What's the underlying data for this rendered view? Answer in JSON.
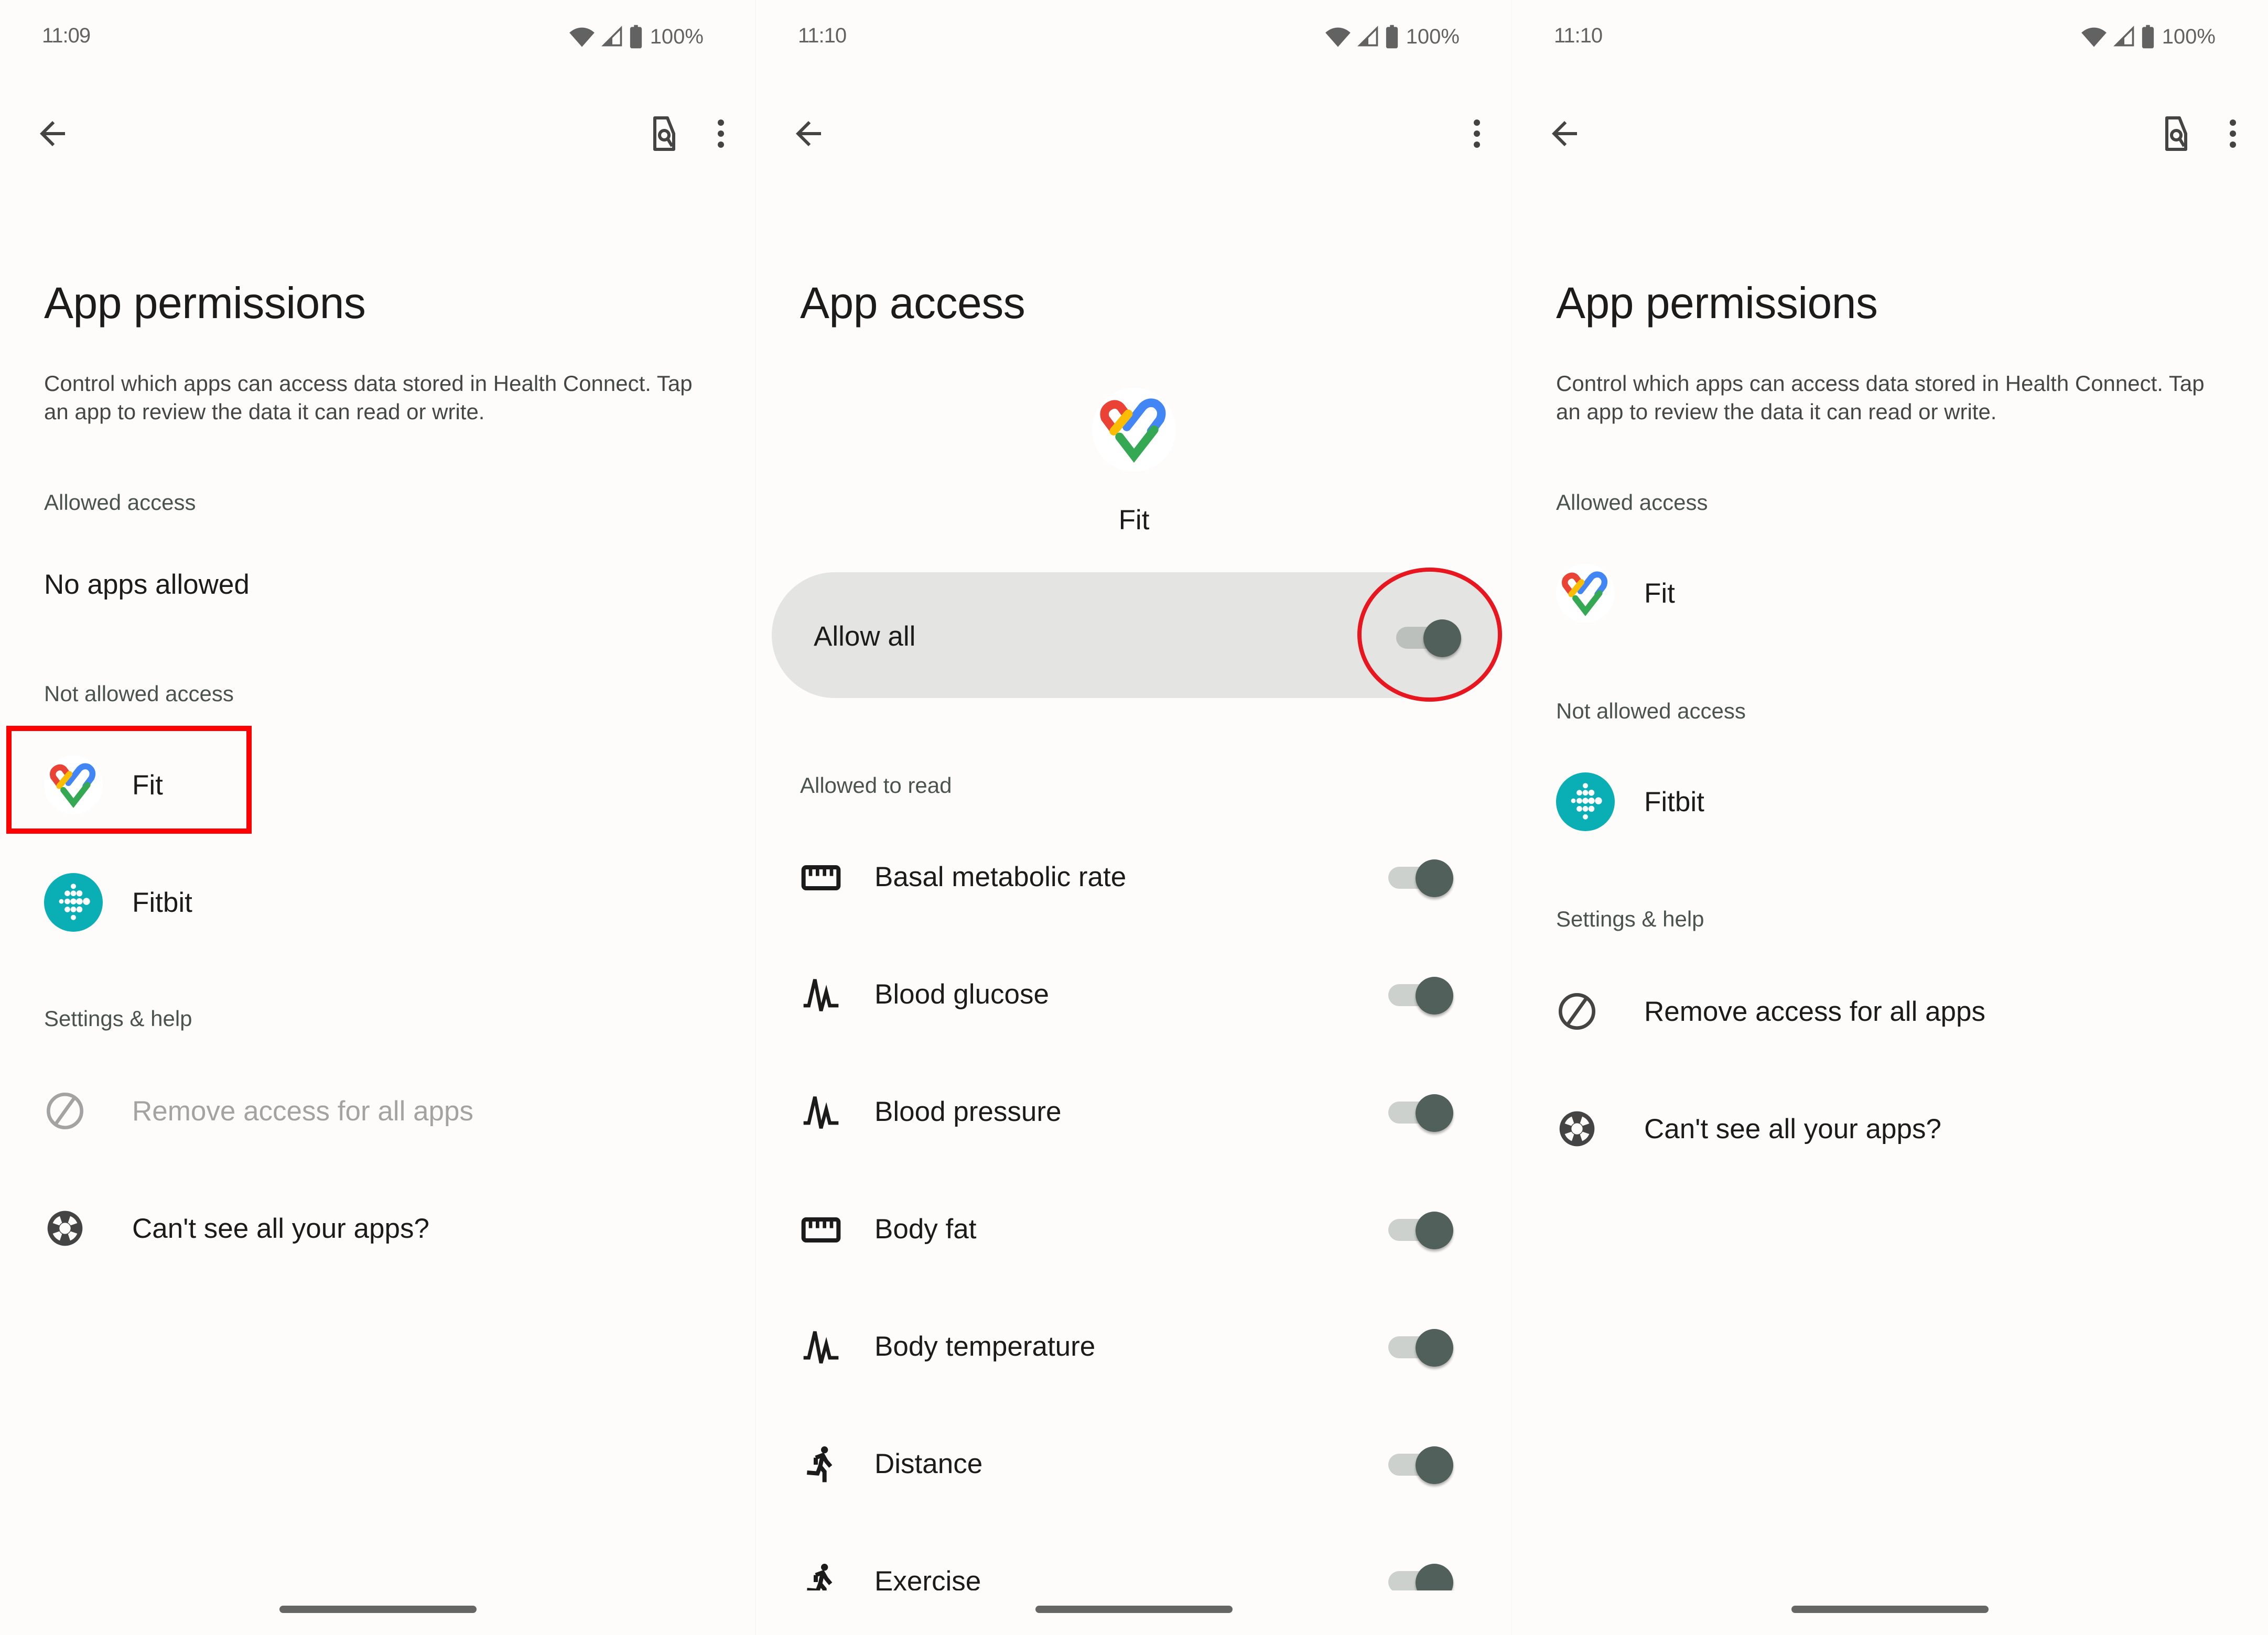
{
  "screens": [
    {
      "status": {
        "time": "11:09",
        "battery": "100%",
        "icons": [
          "wifi-icon",
          "signal-icon",
          "battery-icon"
        ]
      },
      "toolbar": {
        "back": "back-arrow-icon",
        "actions": [
          "search-document-icon",
          "more-vert-icon"
        ]
      },
      "title": "App permissions",
      "description": "Control which apps can access data stored in Health Connect. Tap an app to review the data it can read or write.",
      "sections": {
        "allowed_header": "Allowed access",
        "allowed_empty": "No apps allowed",
        "not_allowed_header": "Not allowed access",
        "not_allowed_apps": [
          {
            "name": "Fit",
            "icon": "google-fit-icon",
            "highlighted": true
          },
          {
            "name": "Fitbit",
            "icon": "fitbit-icon"
          }
        ],
        "settings_header": "Settings & help",
        "settings_items": [
          {
            "label": "Remove access for all apps",
            "icon": "block-icon",
            "enabled": false
          },
          {
            "label": "Can't see all your apps?",
            "icon": "lifebuoy-help-icon",
            "enabled": true
          }
        ]
      },
      "annotation": {
        "type": "rectangle",
        "color": "#ff0000",
        "target": "Fit"
      }
    },
    {
      "status": {
        "time": "11:10",
        "battery": "100%",
        "icons": [
          "wifi-icon",
          "signal-icon",
          "battery-icon"
        ]
      },
      "toolbar": {
        "back": "back-arrow-icon",
        "actions": [
          "more-vert-icon"
        ]
      },
      "title": "App access",
      "app": {
        "name": "Fit",
        "icon": "google-fit-icon"
      },
      "allow_all": {
        "label": "Allow all",
        "checked": true
      },
      "allowed_to_read_header": "Allowed to read",
      "permissions": [
        {
          "label": "Basal metabolic rate",
          "icon": "scale-ruler-icon",
          "checked": true
        },
        {
          "label": "Blood glucose",
          "icon": "vital-signs-icon",
          "checked": true
        },
        {
          "label": "Blood pressure",
          "icon": "vital-signs-icon",
          "checked": true
        },
        {
          "label": "Body fat",
          "icon": "scale-ruler-icon",
          "checked": true
        },
        {
          "label": "Body temperature",
          "icon": "vital-signs-icon",
          "checked": true
        },
        {
          "label": "Distance",
          "icon": "running-person-icon",
          "checked": true
        },
        {
          "label": "Exercise",
          "icon": "running-person-icon",
          "checked": true
        }
      ],
      "annotation": {
        "type": "ellipse",
        "color": "#e8161e",
        "target": "Allow all toggle"
      }
    },
    {
      "status": {
        "time": "11:10",
        "battery": "100%",
        "icons": [
          "wifi-icon",
          "signal-icon",
          "battery-icon"
        ]
      },
      "toolbar": {
        "back": "back-arrow-icon",
        "actions": [
          "search-document-icon",
          "more-vert-icon"
        ]
      },
      "title": "App permissions",
      "description": "Control which apps can access data stored in Health Connect. Tap an app to review the data it can read or write.",
      "sections": {
        "allowed_header": "Allowed access",
        "allowed_apps": [
          {
            "name": "Fit",
            "icon": "google-fit-icon"
          }
        ],
        "not_allowed_header": "Not allowed access",
        "not_allowed_apps": [
          {
            "name": "Fitbit",
            "icon": "fitbit-icon"
          }
        ],
        "settings_header": "Settings & help",
        "settings_items": [
          {
            "label": "Remove access for all apps",
            "icon": "block-icon",
            "enabled": true
          },
          {
            "label": "Can't see all your apps?",
            "icon": "lifebuoy-help-icon",
            "enabled": true
          }
        ]
      }
    }
  ],
  "colors": {
    "background": "#fdfcfb",
    "toggle_thumb": "#51605a",
    "toggle_track": "#cdd1ce",
    "allow_all_card": "#e4e4e3",
    "fitbit_brand": "#0aafb6",
    "section_header": "#4b534e",
    "disabled_text": "#a3a3a3"
  }
}
